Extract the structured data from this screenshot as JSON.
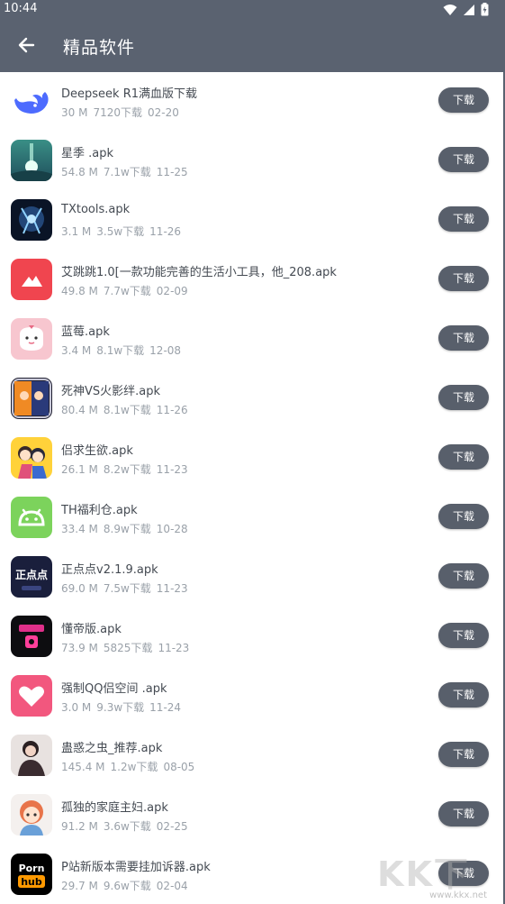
{
  "status_bar": {
    "time": "10:44"
  },
  "header": {
    "title": "精品软件"
  },
  "download_label": "下载",
  "apps": [
    {
      "name": "Deepseek R1满血版下载",
      "size": "30 M",
      "downloads": "7120下载",
      "date": "02-20",
      "icon": "whale-icon"
    },
    {
      "name": "星季 .apk",
      "size": "54.8 M",
      "downloads": "7.1w下载",
      "date": "11-25",
      "icon": "star-season-icon"
    },
    {
      "name": "TXtools.apk",
      "size": "3.1 M",
      "downloads": "3.5w下载",
      "date": "11-26",
      "icon": "txtools-icon"
    },
    {
      "name": "艾跳跳1.0[一款功能完善的生活小工具，他_208.apk",
      "size": "49.8 M",
      "downloads": "7.7w下载",
      "date": "02-09",
      "icon": "mountain-icon"
    },
    {
      "name": "蓝莓.apk",
      "size": "3.4 M",
      "downloads": "8.1w下载",
      "date": "12-08",
      "icon": "blueberry-icon"
    },
    {
      "name": "死神VS火影绊.apk",
      "size": "80.4 M",
      "downloads": "8.1w下载",
      "date": "11-26",
      "icon": "anime-game-icon"
    },
    {
      "name": "侣求生欲.apk",
      "size": "26.1 M",
      "downloads": "8.2w下载",
      "date": "11-23",
      "icon": "couple-icon"
    },
    {
      "name": "TH福利仓.apk",
      "size": "33.4 M",
      "downloads": "8.9w下载",
      "date": "10-28",
      "icon": "android-icon"
    },
    {
      "name": "正点点v2.1.9.apk",
      "size": "69.0 M",
      "downloads": "7.5w下载",
      "date": "11-23",
      "icon": "zhengdiandian-icon",
      "icon_text": "正点点"
    },
    {
      "name": "懂帝版.apk",
      "size": "73.9 M",
      "downloads": "5825下载",
      "date": "11-23",
      "icon": "dongdi-icon"
    },
    {
      "name": "强制QQ侣空间 .apk",
      "size": "3.0 M",
      "downloads": "9.3w下载",
      "date": "11-24",
      "icon": "heart-icon"
    },
    {
      "name": "蛊惑之虫_推荐.apk",
      "size": "145.4 M",
      "downloads": "1.2w下载",
      "date": "08-05",
      "icon": "photo-icon"
    },
    {
      "name": "孤独的家庭主妇.apk",
      "size": "91.2 M",
      "downloads": "3.6w下载",
      "date": "02-25",
      "icon": "cartoon-girl-icon"
    },
    {
      "name": "P站新版本需要挂加诉器.apk",
      "size": "29.7 M",
      "downloads": "9.6w下载",
      "date": "02-04",
      "icon": "ph-logo-icon",
      "icon_text": [
        "Porn",
        "hub"
      ]
    }
  ],
  "watermark": {
    "big": "KK下载",
    "small": "www.kkx.net"
  }
}
